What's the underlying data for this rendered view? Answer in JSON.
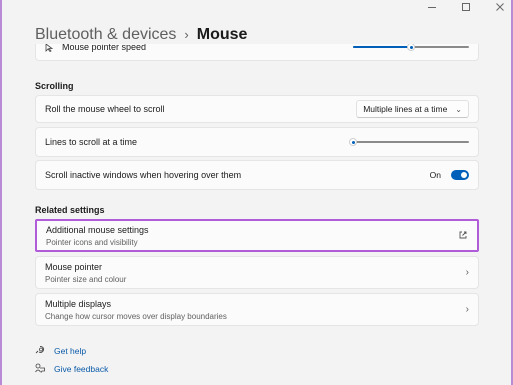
{
  "breadcrumb": {
    "parent": "Bluetooth & devices",
    "separator": "›",
    "current": "Mouse"
  },
  "pointer_speed": {
    "label": "Mouse pointer speed",
    "value_fraction": 0.5
  },
  "scrolling": {
    "heading": "Scrolling",
    "wheel_label": "Roll the mouse wheel to scroll",
    "wheel_value": "Multiple lines at a time",
    "lines_label": "Lines to scroll at a time",
    "lines_value_fraction": 0.0,
    "inactive_label": "Scroll inactive windows when hovering over them",
    "inactive_state": "On"
  },
  "related": {
    "heading": "Related settings",
    "items": [
      {
        "title": "Additional mouse settings",
        "subtitle": "Pointer icons and visibility",
        "icon": "open-external-icon"
      },
      {
        "title": "Mouse pointer",
        "subtitle": "Pointer size and colour",
        "icon": "chevron-right-icon"
      },
      {
        "title": "Multiple displays",
        "subtitle": "Change how cursor moves over display boundaries",
        "icon": "chevron-right-icon"
      }
    ]
  },
  "footer": {
    "help": "Get help",
    "feedback": "Give feedback"
  },
  "colors": {
    "accent": "#005fb8",
    "highlight": "#b05bd8",
    "link": "#0a5aa8"
  }
}
